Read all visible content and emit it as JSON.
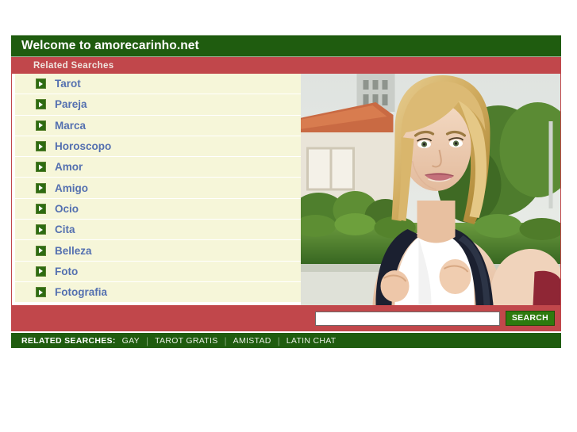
{
  "header": {
    "title": "Welcome to amorecarinho.net",
    "subtitle": "Related Searches"
  },
  "sidebar": {
    "bullet_icon": "play-arrow-icon",
    "items": [
      {
        "label": "Tarot"
      },
      {
        "label": "Pareja"
      },
      {
        "label": "Marca"
      },
      {
        "label": "Horoscopo"
      },
      {
        "label": "Amor"
      },
      {
        "label": "Amigo"
      },
      {
        "label": "Ocio"
      },
      {
        "label": "Cita"
      },
      {
        "label": "Belleza"
      },
      {
        "label": "Foto"
      },
      {
        "label": "Fotografia"
      }
    ]
  },
  "photo": {
    "alt": "smiling blonde woman wearing a backpack outdoors in front of a house with hedges"
  },
  "search": {
    "value": "",
    "placeholder": "",
    "button_label": "SEARCH"
  },
  "footer": {
    "label": "RELATED SEARCHES:",
    "separator": "|",
    "links": [
      {
        "label": "GAY"
      },
      {
        "label": "TAROT GRATIS"
      },
      {
        "label": "AMISTAD"
      },
      {
        "label": "LATIN CHAT"
      }
    ]
  },
  "colors": {
    "dark_green": "#1f5c0f",
    "red": "#c1474b",
    "cream": "#f6f6d9",
    "link_blue": "#5470b0",
    "button_green": "#2e7a0e"
  }
}
